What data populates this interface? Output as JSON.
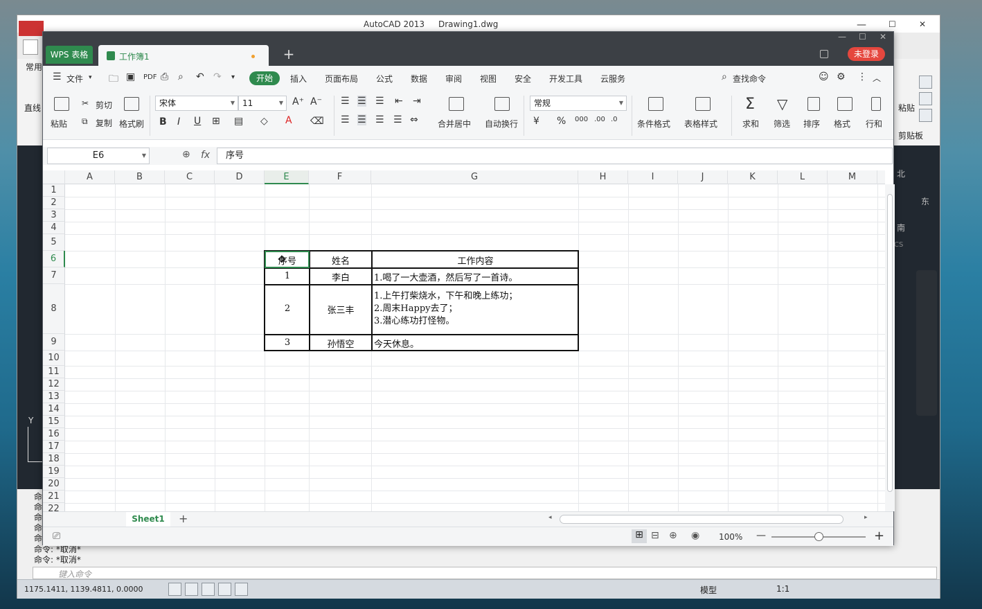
{
  "cad": {
    "app_title": "AutoCAD 2013",
    "doc_title": "Drawing1.dwg",
    "ribbon_tab": "常用",
    "line_tool": "直线",
    "paste_label": "粘贴",
    "clipboard_label": "剪贴板",
    "compass": {
      "north": "北",
      "east": "东",
      "south": "南",
      "wcs": "CS"
    },
    "y_axis": "Y",
    "cmd_history": [
      "命",
      "命",
      "命",
      "命",
      "命"
    ],
    "cmd_cancel_1": "命令: *取消*",
    "cmd_cancel_2": "命令: *取消*",
    "cmd_placeholder": "键入命令",
    "coords": "1175.1411, 1139.4811, 0.0000",
    "model_label": "模型",
    "scale_label": "1:1"
  },
  "wps": {
    "brand": "WPS 表格",
    "tab_title": "工作簿1",
    "login": "未登录",
    "menu": {
      "file": "文件",
      "items": [
        "开始",
        "插入",
        "页面布局",
        "公式",
        "数据",
        "审阅",
        "视图",
        "安全",
        "开发工具",
        "云服务"
      ],
      "search": "查找命令"
    },
    "toolbar": {
      "paste": "粘贴",
      "cut": "剪切",
      "copy": "复制",
      "format_painter": "格式刷",
      "font_name": "宋体",
      "font_size": "11",
      "merge_center": "合并居中",
      "wrap": "自动换行",
      "number_format": "常规",
      "cond_format": "条件格式",
      "table_style": "表格样式",
      "sum": "求和",
      "filter": "筛选",
      "sort": "排序",
      "format": "格式",
      "row_col": "行和"
    },
    "formula_bar": {
      "name_box": "E6",
      "fx": "fx",
      "content": "序号"
    },
    "columns": [
      "A",
      "B",
      "C",
      "D",
      "E",
      "F",
      "G",
      "H",
      "I",
      "J",
      "K",
      "L",
      "M"
    ],
    "rows": [
      "1",
      "2",
      "3",
      "4",
      "5",
      "6",
      "7",
      "8",
      "9",
      "10",
      "11",
      "12",
      "13",
      "14",
      "15",
      "16",
      "17",
      "18",
      "19",
      "20",
      "21",
      "22"
    ],
    "table": {
      "headers": [
        "序号",
        "姓名",
        "工作内容"
      ],
      "rows": [
        {
          "no": "1",
          "name": "李白",
          "work": "1.喝了一大壶酒，然后写了一首诗。"
        },
        {
          "no": "2",
          "name": "张三丰",
          "work": "1.上午打柴烧水，下午和晚上练功；\n2.周末Happy去了；\n3.潜心练功打怪物。"
        },
        {
          "no": "3",
          "name": "孙悟空",
          "work": "今天休息。"
        }
      ]
    },
    "sheet_tab": "Sheet1",
    "zoom": "100%",
    "accent": "#2f8a4e",
    "login_color": "#e5473e"
  }
}
